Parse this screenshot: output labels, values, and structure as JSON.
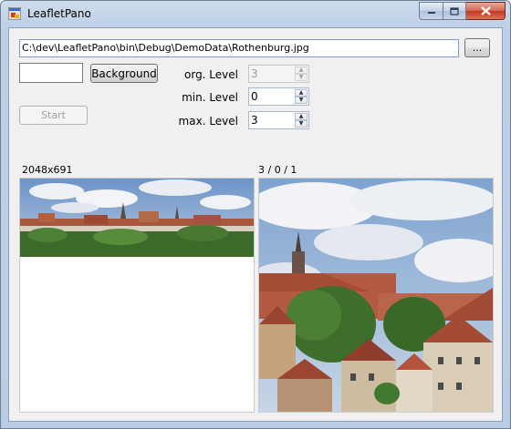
{
  "window": {
    "title": "LeafletPano"
  },
  "path_field": {
    "value": "C:\\dev\\LeafletPano\\bin\\Debug\\DemoData\\Rothenburg.jpg"
  },
  "browse_button": {
    "label": "..."
  },
  "color_field": {
    "value": ""
  },
  "background_button": {
    "label": "Background"
  },
  "start_button": {
    "label": "Start"
  },
  "levels": {
    "org": {
      "label": "org. Level",
      "value": "3"
    },
    "min": {
      "label": "min. Level",
      "value": "0"
    },
    "max": {
      "label": "max. Level",
      "value": "3"
    }
  },
  "left_panel": {
    "caption": "2048x691"
  },
  "right_panel": {
    "caption": "3 / 0 / 1"
  },
  "colors": {
    "accent": "#7a9cd3",
    "client_bg": "#f0f0f0",
    "close_red": "#c2381c"
  }
}
